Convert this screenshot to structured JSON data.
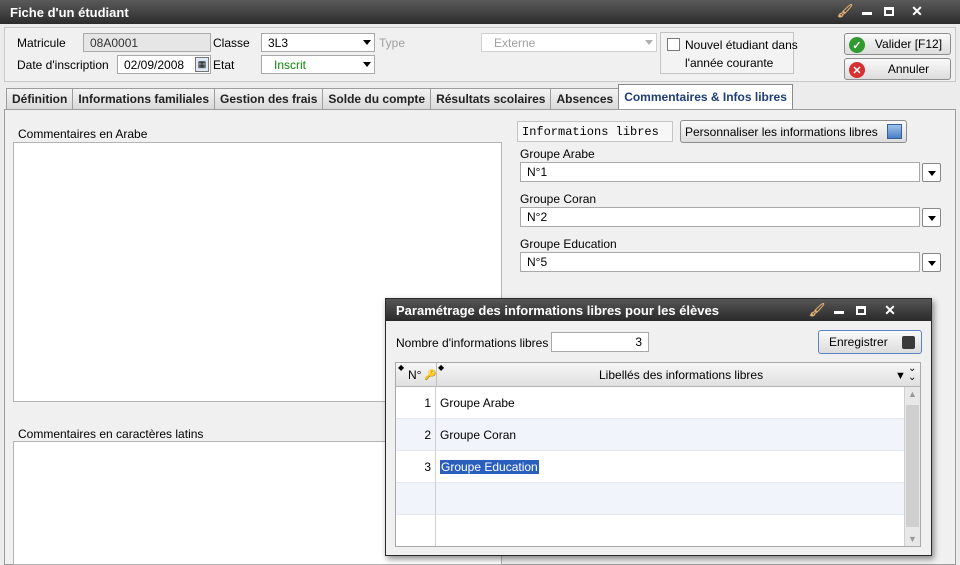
{
  "window": {
    "title": "Fiche d'un étudiant"
  },
  "header": {
    "matricule_label": "Matricule",
    "matricule_value": "08A0001",
    "date_label": "Date d'inscription",
    "date_value": "02/09/2008",
    "classe_label": "Classe",
    "classe_value": "3L3",
    "type_label": "Type",
    "type_value": "Externe",
    "etat_label": "Etat",
    "etat_value": "Inscrit",
    "nouvel_line1": "Nouvel étudiant dans",
    "nouvel_line2": "l'année courante",
    "valider_label": "Valider [F12]",
    "annuler_label": "Annuler"
  },
  "tabs": [
    {
      "label": "Définition"
    },
    {
      "label": "Informations familiales"
    },
    {
      "label": "Gestion des frais"
    },
    {
      "label": "Solde du compte"
    },
    {
      "label": "Résultats scolaires"
    },
    {
      "label": "Absences"
    },
    {
      "label": "Commentaires & Infos libres"
    }
  ],
  "content": {
    "comments_arabe_label": "Commentaires en Arabe",
    "comments_latin_label": "Commentaires en caractères latins",
    "infos_libres_label": "Informations libres",
    "personnaliser_label": "Personnaliser les informations libres",
    "groups": [
      {
        "label": "Groupe Arabe",
        "value": "N°1"
      },
      {
        "label": "Groupe Coran",
        "value": "N°2"
      },
      {
        "label": "Groupe Education",
        "value": "N°5"
      }
    ]
  },
  "dialog": {
    "title": "Paramétrage des informations libres pour les élèves",
    "nombre_label": "Nombre d'informations libres",
    "nombre_value": "3",
    "enregistrer_label": "Enregistrer",
    "col_num": "N°",
    "col_libelles": "Libellés des informations libres",
    "rows": [
      {
        "num": "1",
        "label": "Groupe Arabe"
      },
      {
        "num": "2",
        "label": "Groupe Coran"
      },
      {
        "num": "3",
        "label": "Groupe Education"
      }
    ]
  }
}
